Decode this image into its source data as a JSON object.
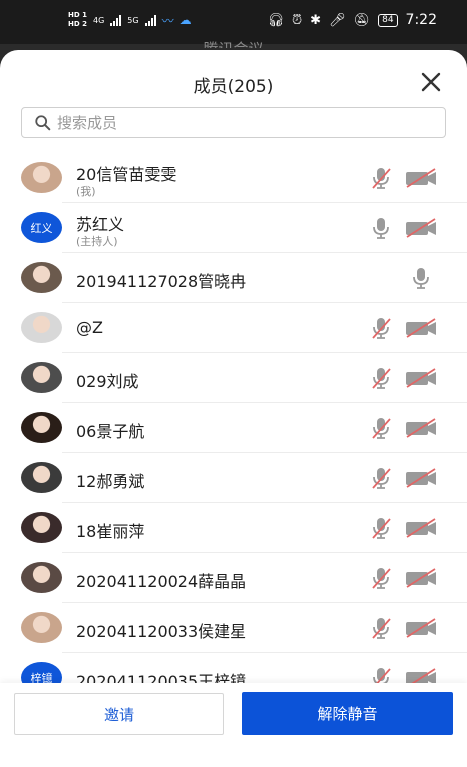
{
  "status_bar": {
    "hd1": "HD 1",
    "hd2": "HD 2",
    "net1": "4G",
    "net2": "5G",
    "battery": "84",
    "time": "7:22"
  },
  "behind_title": "腾讯会议",
  "sheet": {
    "title": "成员(205)",
    "close_icon": "close-icon"
  },
  "search": {
    "placeholder": "搜索成员",
    "value": ""
  },
  "members": [
    {
      "name": "20信管苗雯雯",
      "sub": "(我)",
      "avatar": "photo",
      "mic": "muted",
      "cam": "off"
    },
    {
      "name": "苏红义",
      "sub": "(主持人)",
      "avatar_text": "红义",
      "avatar": "text",
      "mic": "on",
      "cam": "off"
    },
    {
      "name": "201941127028管晓冉",
      "sub": "",
      "avatar": "photo",
      "mic": "on-solo",
      "cam": "none"
    },
    {
      "name": "@Z",
      "sub": "",
      "avatar": "photo",
      "mic": "muted",
      "cam": "off"
    },
    {
      "name": "029刘成",
      "sub": "",
      "avatar": "photo",
      "mic": "muted",
      "cam": "off"
    },
    {
      "name": "06景子航",
      "sub": "",
      "avatar": "photo",
      "mic": "muted",
      "cam": "off"
    },
    {
      "name": "12郝勇斌",
      "sub": "",
      "avatar": "photo",
      "mic": "muted",
      "cam": "off"
    },
    {
      "name": "18崔丽萍",
      "sub": "",
      "avatar": "photo",
      "mic": "muted",
      "cam": "off"
    },
    {
      "name": "202041120024薛晶晶",
      "sub": "",
      "avatar": "photo",
      "mic": "muted",
      "cam": "off"
    },
    {
      "name": "202041120033侯建星",
      "sub": "",
      "avatar": "photo",
      "mic": "muted",
      "cam": "off"
    },
    {
      "name": "202041120035王梓镱",
      "sub": "",
      "avatar_text": "梓镱",
      "avatar": "text",
      "mic": "muted",
      "cam": "off"
    }
  ],
  "footer": {
    "invite_label": "邀请",
    "unmute_label": "解除静音"
  },
  "colors": {
    "primary": "#0c53d8",
    "muted_red": "#e06666",
    "icon_gray": "#9a9a9a"
  }
}
